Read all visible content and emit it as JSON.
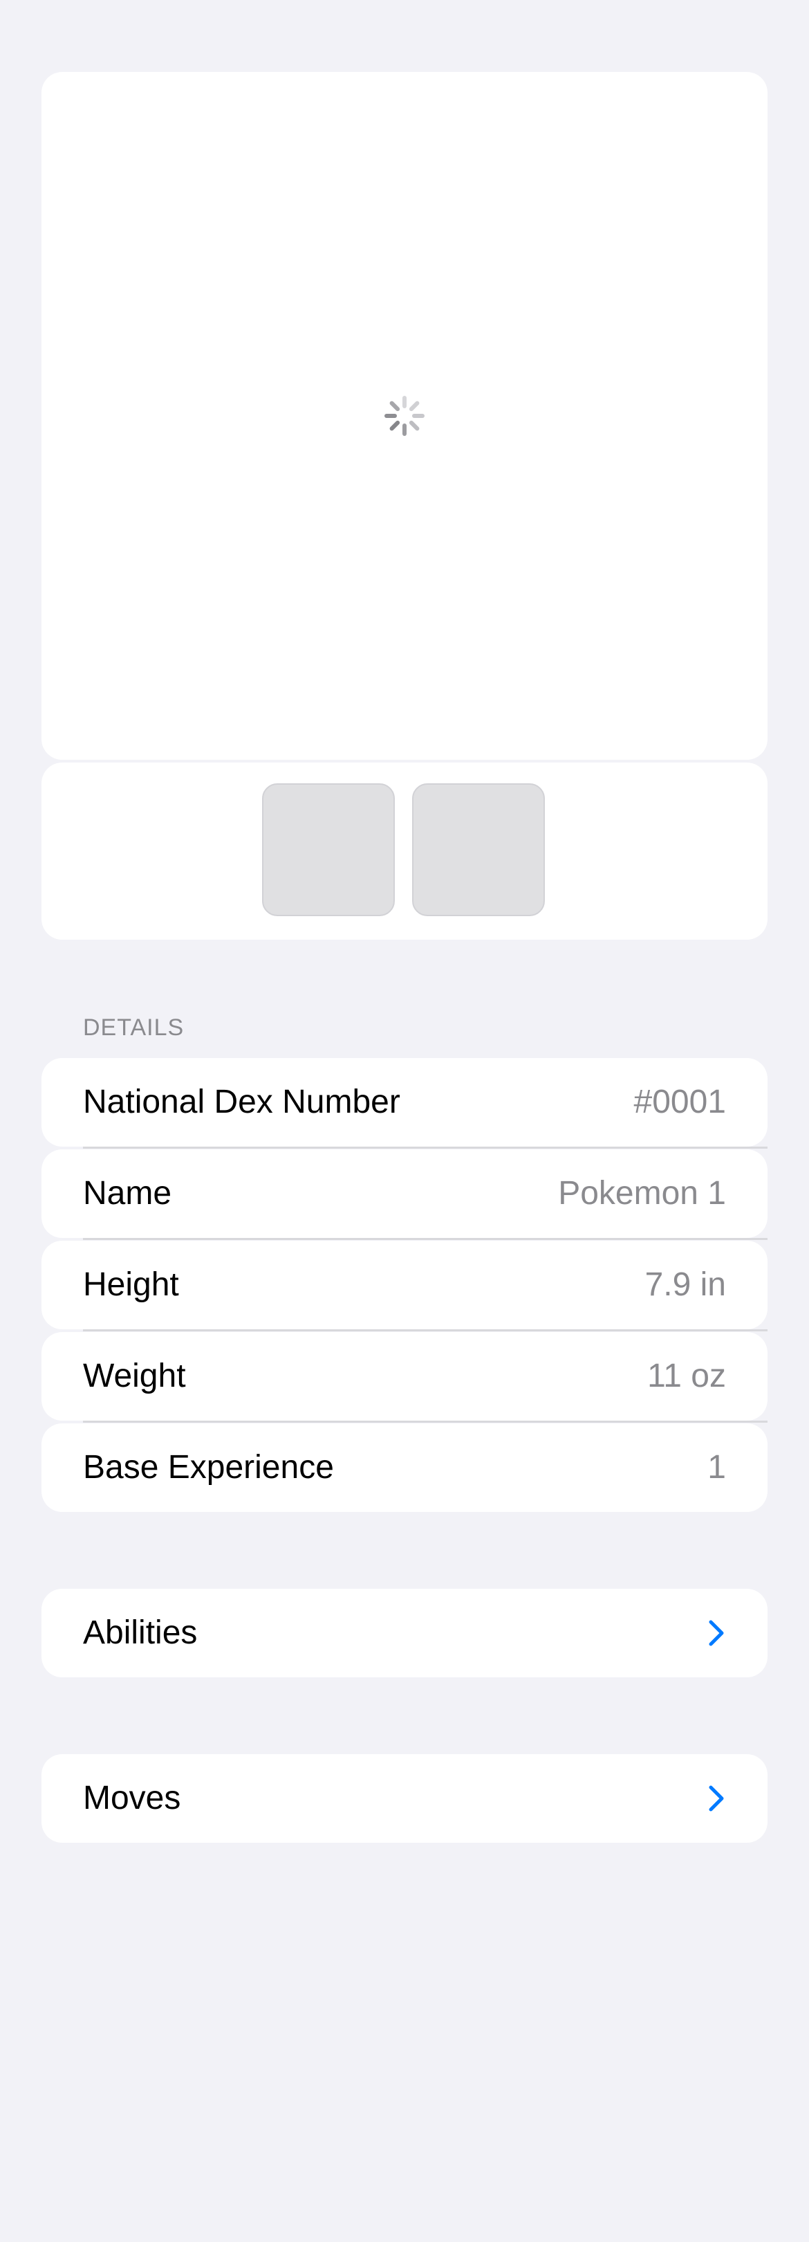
{
  "media": {
    "loading_indicator": "activity-spinner",
    "thumbnail_count": 2
  },
  "details": {
    "header": "DETAILS",
    "rows": [
      {
        "label": "National Dex Number",
        "value": "#0001"
      },
      {
        "label": "Name",
        "value": "Pokemon 1"
      },
      {
        "label": "Height",
        "value": "7.9 in"
      },
      {
        "label": "Weight",
        "value": "11 oz"
      },
      {
        "label": "Base Experience",
        "value": "1"
      }
    ]
  },
  "navigation": {
    "abilities_label": "Abilities",
    "moves_label": "Moves",
    "chevron_icon": "chevron-right-icon"
  },
  "colors": {
    "background": "#f2f2f7",
    "card": "#ffffff",
    "secondary_text": "#8a8a8e",
    "accent": "#007aff"
  }
}
